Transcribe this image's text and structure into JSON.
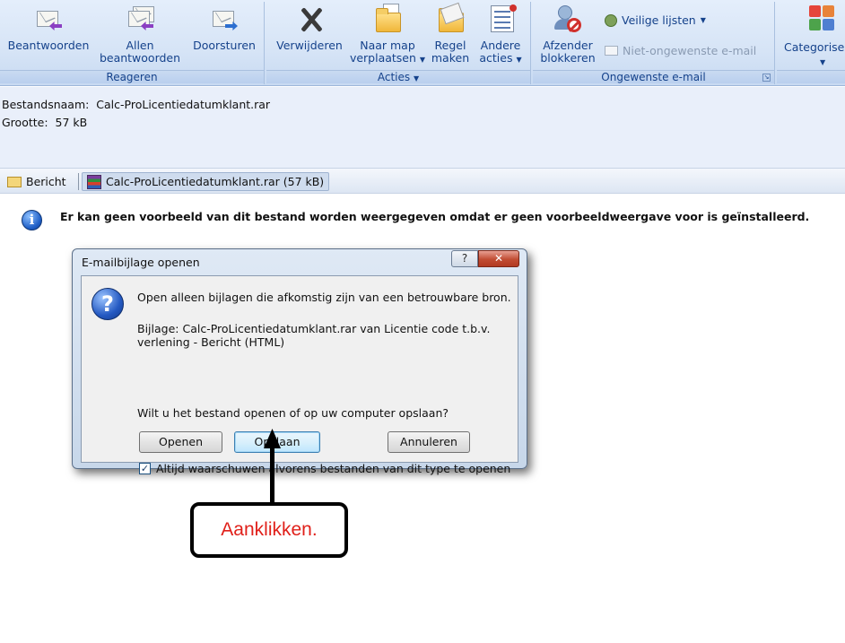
{
  "ribbon": {
    "groups": {
      "respond": {
        "label": "Reageren",
        "reply": "Beantwoorden",
        "reply_all_1": "Allen",
        "reply_all_2": "beantwoorden",
        "forward": "Doorsturen"
      },
      "actions": {
        "label": "Acties",
        "delete": "Verwijderen",
        "move_1": "Naar map",
        "move_2": "verplaatsen",
        "rule_1": "Regel",
        "rule_2": "maken",
        "other_1": "Andere",
        "other_2": "acties"
      },
      "junk": {
        "label": "Ongewenste e-mail",
        "block_1": "Afzender",
        "block_2": "blokkeren",
        "safe_lists": "Veilige lijsten",
        "not_junk": "Niet-ongewenste e-mail"
      },
      "categorize": {
        "label": "Categorise"
      }
    }
  },
  "header": {
    "filename_label": "Bestandsnaam:",
    "filename_value": "Calc-ProLicentiedatumklant.rar",
    "size_label": "Grootte:",
    "size_value": "57 kB"
  },
  "tabs": {
    "message": "Bericht",
    "attachment": "Calc-ProLicentiedatumklant.rar (57 kB)"
  },
  "preview_message": "Er kan geen voorbeeld van dit bestand worden weergegeven omdat er geen voorbeeldweergave voor is geïnstalleerd.",
  "dialog": {
    "title": "E-mailbijlage openen",
    "help_glyph": "?",
    "close_glyph": "✕",
    "warning": "Open alleen bijlagen die afkomstig zijn van een betrouwbare bron.",
    "attachment_line_1": "Bijlage: Calc-ProLicentiedatumklant.rar van Licentie code t.b.v.",
    "attachment_line_2": "verlening - Bericht (HTML)",
    "question": "Wilt u het bestand openen of op uw computer opslaan?",
    "open_button": "Openen",
    "save_button": "Opslaan",
    "cancel_button": "Annuleren",
    "always_warn": "Altijd waarschuwen alvorens bestanden van dit type te openen",
    "always_warn_checked": true
  },
  "annotation": {
    "text": "Aanklikken."
  },
  "colors": {
    "ribbon_text": "#15428b",
    "annotation_text": "#e0201a"
  }
}
